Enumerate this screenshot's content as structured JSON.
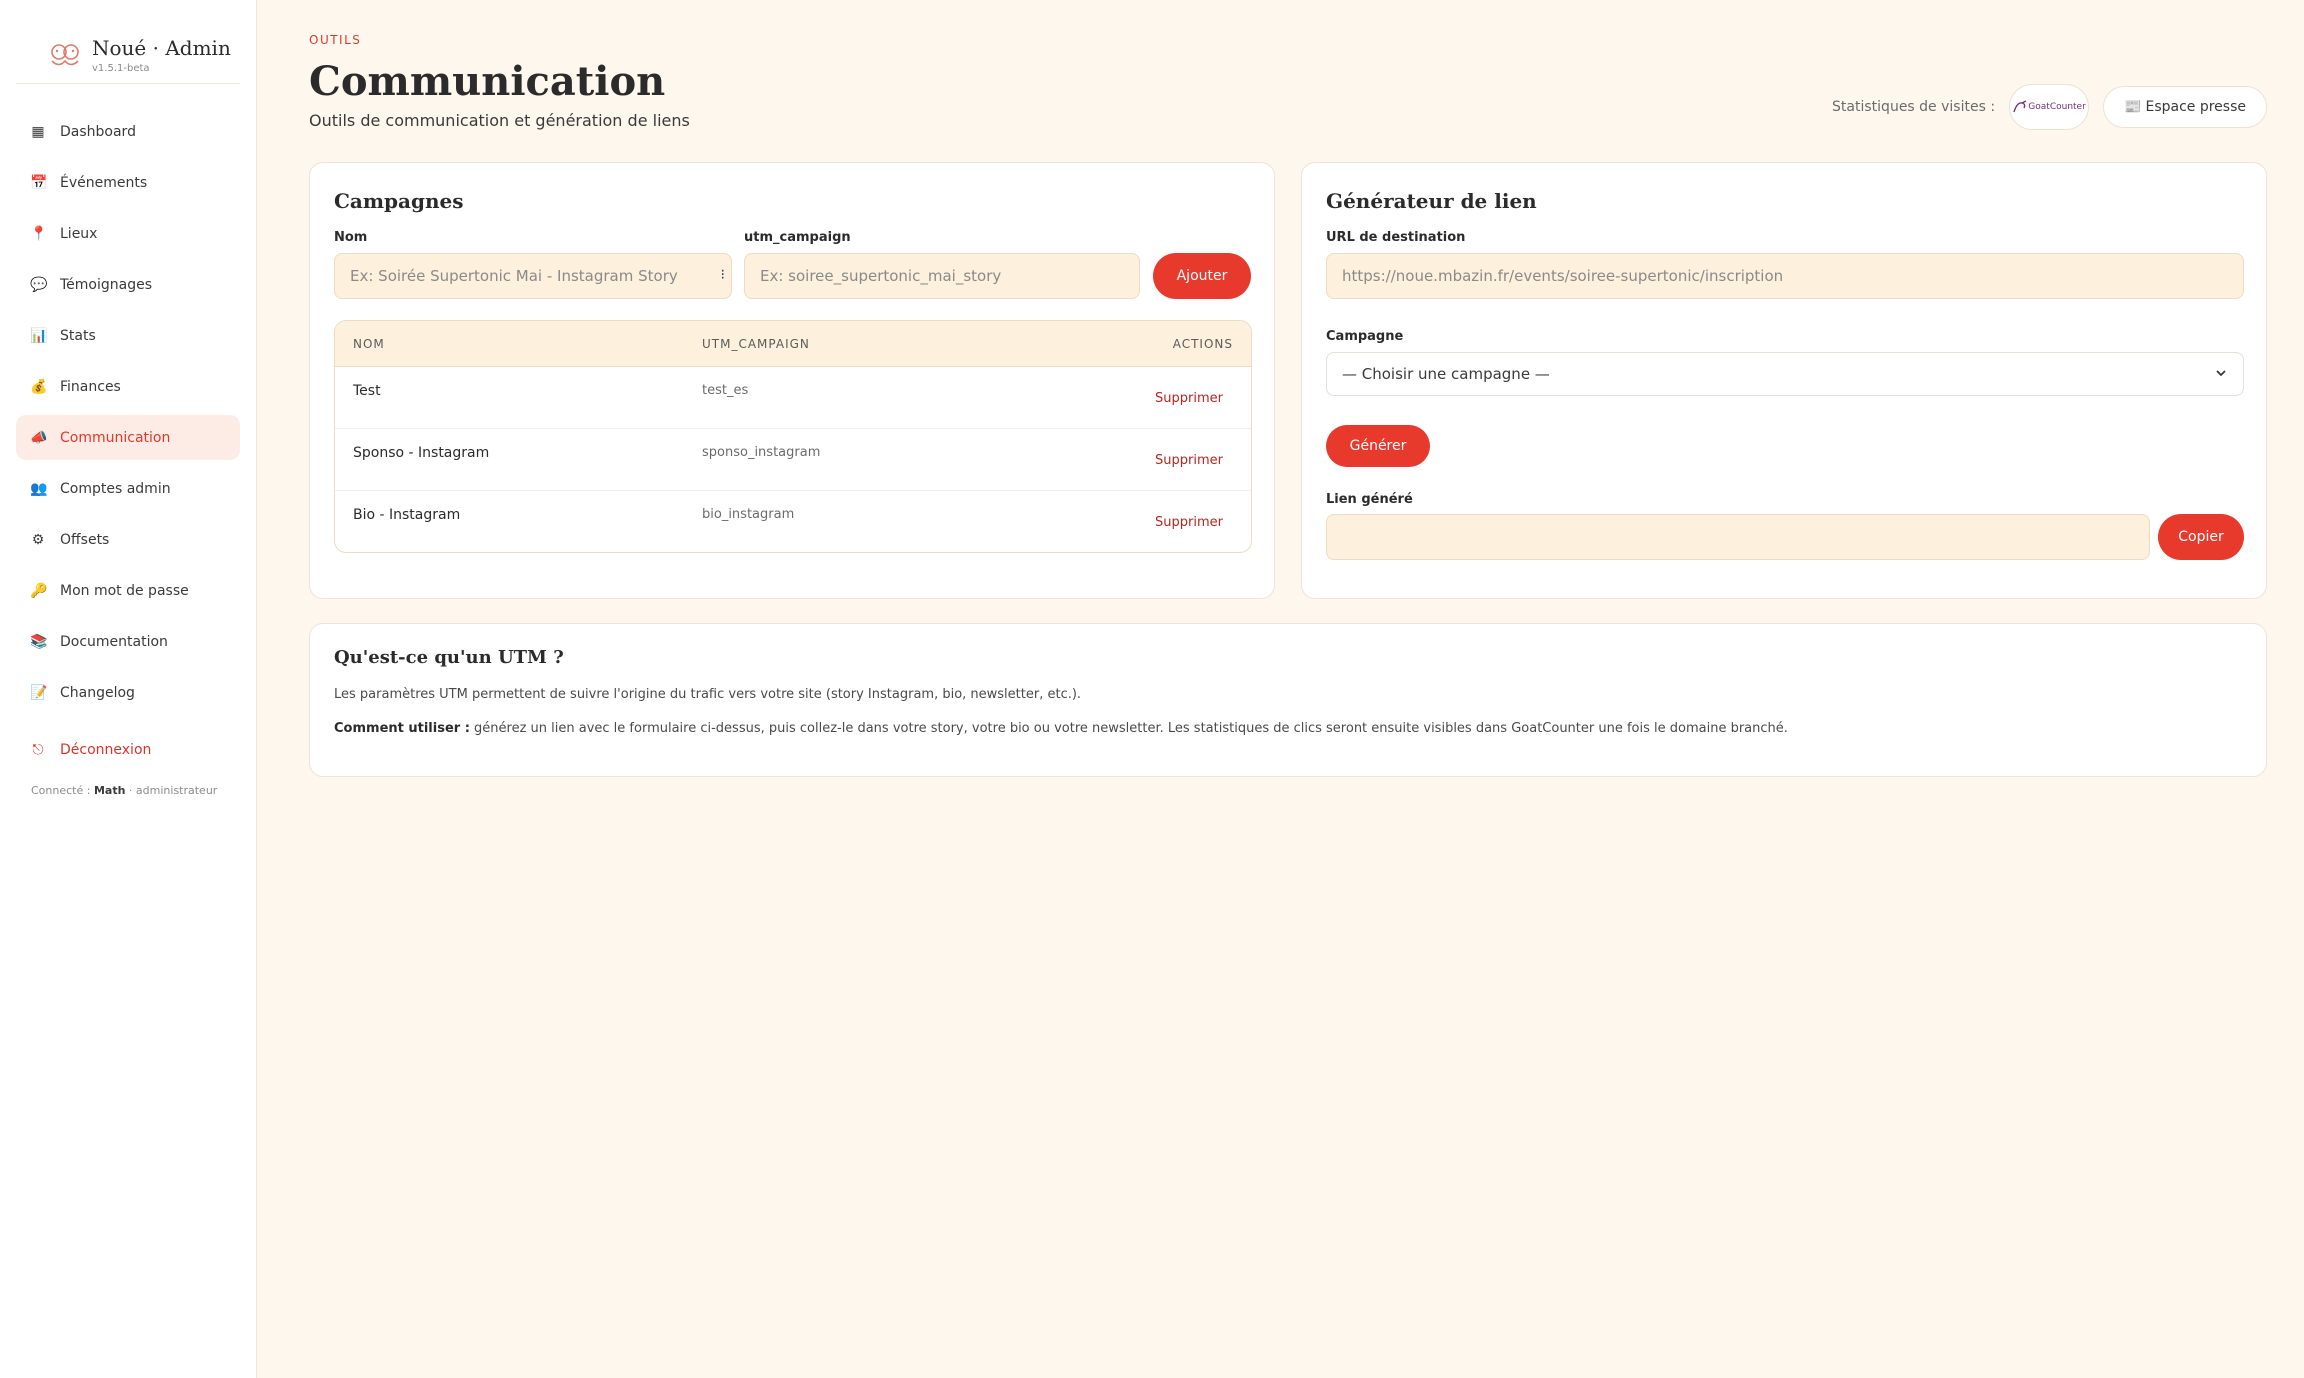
{
  "app": {
    "title": "Noué · Admin",
    "version": "v1.5.1-beta"
  },
  "sidebar": {
    "items": [
      {
        "icon": "dashboard-icon",
        "glyph": "▦",
        "label": "Dashboard",
        "active": false
      },
      {
        "icon": "calendar-icon",
        "glyph": "📅",
        "label": "Événements",
        "active": false
      },
      {
        "icon": "pin-icon",
        "glyph": "📍",
        "label": "Lieux",
        "active": false
      },
      {
        "icon": "speech-bubble-icon",
        "glyph": "💬",
        "label": "Témoignages",
        "active": false
      },
      {
        "icon": "bar-chart-icon",
        "glyph": "📊",
        "label": "Stats",
        "active": false
      },
      {
        "icon": "money-bag-icon",
        "glyph": "💰",
        "label": "Finances",
        "active": false
      },
      {
        "icon": "megaphone-icon",
        "glyph": "📣",
        "label": "Communication",
        "active": true
      },
      {
        "icon": "users-icon",
        "glyph": "👥",
        "label": "Comptes admin",
        "active": false
      },
      {
        "icon": "gear-icon",
        "glyph": "⚙",
        "label": "Offsets",
        "active": false
      },
      {
        "icon": "key-icon",
        "glyph": "🔑",
        "label": "Mon mot de passe",
        "active": false
      },
      {
        "icon": "books-icon",
        "glyph": "📚",
        "label": "Documentation",
        "active": false
      },
      {
        "icon": "memo-icon",
        "glyph": "📝",
        "label": "Changelog",
        "active": false
      }
    ],
    "logout": {
      "icon": "logout-icon",
      "glyph": "⎋",
      "label": "Déconnexion"
    },
    "connected": {
      "prefix": "Connecté :",
      "user": "Math",
      "role": "· administrateur"
    }
  },
  "header": {
    "eyebrow": "OUTILS",
    "title": "Communication",
    "subtitle": "Outils de communication et génération de liens",
    "stats_label": "Statistiques de visites :",
    "goatcounter_label": "GoatCounter",
    "press_label": "Espace presse",
    "press_glyph": "📰"
  },
  "campaigns": {
    "title": "Campagnes",
    "name_label": "Nom",
    "name_placeholder": "Ex: Soirée Supertonic Mai - Instagram Story",
    "utm_label": "utm_campaign",
    "utm_placeholder": "Ex: soiree_supertonic_mai_story",
    "add_label": "Ajouter",
    "columns": [
      "NOM",
      "UTM_CAMPAIGN",
      "ACTIONS"
    ],
    "rows": [
      {
        "name": "Test",
        "utm": "test_es",
        "action": "Supprimer"
      },
      {
        "name": "Sponso - Instagram",
        "utm": "sponso_instagram",
        "action": "Supprimer"
      },
      {
        "name": "Bio - Instagram",
        "utm": "bio_instagram",
        "action": "Supprimer"
      }
    ]
  },
  "generator": {
    "title": "Générateur de lien",
    "url_label": "URL de destination",
    "url_placeholder": "https://noue.mbazin.fr/events/soiree-supertonic/inscription",
    "campaign_label": "Campagne",
    "campaign_selected": "— Choisir une campagne —",
    "generate_label": "Générer",
    "generated_label": "Lien généré",
    "generated_value": "",
    "copy_label": "Copier"
  },
  "utm_info": {
    "title": "Qu'est-ce qu'un UTM ?",
    "paragraph": "Les paramètres UTM permettent de suivre l'origine du trafic vers votre site (story Instagram, bio, newsletter, etc.).",
    "howto_bold": "Comment utiliser :",
    "howto_text": " générez un lien avec le formulaire ci-dessus, puis collez-le dans votre story, votre bio ou votre newsletter. Les statistiques de clics seront ensuite visibles dans GoatCounter une fois le domaine branché."
  },
  "colors": {
    "accent": "#e8392d",
    "background": "#fdf7ee",
    "input_bg": "#fdf0dc"
  }
}
